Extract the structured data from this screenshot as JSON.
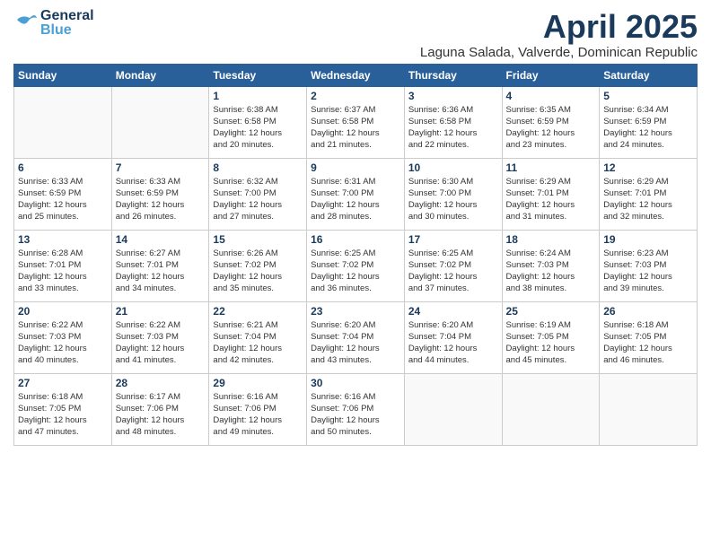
{
  "header": {
    "logo": {
      "general": "General",
      "blue": "Blue"
    },
    "title": "April 2025",
    "location": "Laguna Salada, Valverde, Dominican Republic"
  },
  "columns": [
    "Sunday",
    "Monday",
    "Tuesday",
    "Wednesday",
    "Thursday",
    "Friday",
    "Saturday"
  ],
  "weeks": [
    {
      "days": [
        {
          "num": "",
          "detail": ""
        },
        {
          "num": "",
          "detail": ""
        },
        {
          "num": "1",
          "detail": "Sunrise: 6:38 AM\nSunset: 6:58 PM\nDaylight: 12 hours\nand 20 minutes."
        },
        {
          "num": "2",
          "detail": "Sunrise: 6:37 AM\nSunset: 6:58 PM\nDaylight: 12 hours\nand 21 minutes."
        },
        {
          "num": "3",
          "detail": "Sunrise: 6:36 AM\nSunset: 6:58 PM\nDaylight: 12 hours\nand 22 minutes."
        },
        {
          "num": "4",
          "detail": "Sunrise: 6:35 AM\nSunset: 6:59 PM\nDaylight: 12 hours\nand 23 minutes."
        },
        {
          "num": "5",
          "detail": "Sunrise: 6:34 AM\nSunset: 6:59 PM\nDaylight: 12 hours\nand 24 minutes."
        }
      ]
    },
    {
      "days": [
        {
          "num": "6",
          "detail": "Sunrise: 6:33 AM\nSunset: 6:59 PM\nDaylight: 12 hours\nand 25 minutes."
        },
        {
          "num": "7",
          "detail": "Sunrise: 6:33 AM\nSunset: 6:59 PM\nDaylight: 12 hours\nand 26 minutes."
        },
        {
          "num": "8",
          "detail": "Sunrise: 6:32 AM\nSunset: 7:00 PM\nDaylight: 12 hours\nand 27 minutes."
        },
        {
          "num": "9",
          "detail": "Sunrise: 6:31 AM\nSunset: 7:00 PM\nDaylight: 12 hours\nand 28 minutes."
        },
        {
          "num": "10",
          "detail": "Sunrise: 6:30 AM\nSunset: 7:00 PM\nDaylight: 12 hours\nand 30 minutes."
        },
        {
          "num": "11",
          "detail": "Sunrise: 6:29 AM\nSunset: 7:01 PM\nDaylight: 12 hours\nand 31 minutes."
        },
        {
          "num": "12",
          "detail": "Sunrise: 6:29 AM\nSunset: 7:01 PM\nDaylight: 12 hours\nand 32 minutes."
        }
      ]
    },
    {
      "days": [
        {
          "num": "13",
          "detail": "Sunrise: 6:28 AM\nSunset: 7:01 PM\nDaylight: 12 hours\nand 33 minutes."
        },
        {
          "num": "14",
          "detail": "Sunrise: 6:27 AM\nSunset: 7:01 PM\nDaylight: 12 hours\nand 34 minutes."
        },
        {
          "num": "15",
          "detail": "Sunrise: 6:26 AM\nSunset: 7:02 PM\nDaylight: 12 hours\nand 35 minutes."
        },
        {
          "num": "16",
          "detail": "Sunrise: 6:25 AM\nSunset: 7:02 PM\nDaylight: 12 hours\nand 36 minutes."
        },
        {
          "num": "17",
          "detail": "Sunrise: 6:25 AM\nSunset: 7:02 PM\nDaylight: 12 hours\nand 37 minutes."
        },
        {
          "num": "18",
          "detail": "Sunrise: 6:24 AM\nSunset: 7:03 PM\nDaylight: 12 hours\nand 38 minutes."
        },
        {
          "num": "19",
          "detail": "Sunrise: 6:23 AM\nSunset: 7:03 PM\nDaylight: 12 hours\nand 39 minutes."
        }
      ]
    },
    {
      "days": [
        {
          "num": "20",
          "detail": "Sunrise: 6:22 AM\nSunset: 7:03 PM\nDaylight: 12 hours\nand 40 minutes."
        },
        {
          "num": "21",
          "detail": "Sunrise: 6:22 AM\nSunset: 7:03 PM\nDaylight: 12 hours\nand 41 minutes."
        },
        {
          "num": "22",
          "detail": "Sunrise: 6:21 AM\nSunset: 7:04 PM\nDaylight: 12 hours\nand 42 minutes."
        },
        {
          "num": "23",
          "detail": "Sunrise: 6:20 AM\nSunset: 7:04 PM\nDaylight: 12 hours\nand 43 minutes."
        },
        {
          "num": "24",
          "detail": "Sunrise: 6:20 AM\nSunset: 7:04 PM\nDaylight: 12 hours\nand 44 minutes."
        },
        {
          "num": "25",
          "detail": "Sunrise: 6:19 AM\nSunset: 7:05 PM\nDaylight: 12 hours\nand 45 minutes."
        },
        {
          "num": "26",
          "detail": "Sunrise: 6:18 AM\nSunset: 7:05 PM\nDaylight: 12 hours\nand 46 minutes."
        }
      ]
    },
    {
      "days": [
        {
          "num": "27",
          "detail": "Sunrise: 6:18 AM\nSunset: 7:05 PM\nDaylight: 12 hours\nand 47 minutes."
        },
        {
          "num": "28",
          "detail": "Sunrise: 6:17 AM\nSunset: 7:06 PM\nDaylight: 12 hours\nand 48 minutes."
        },
        {
          "num": "29",
          "detail": "Sunrise: 6:16 AM\nSunset: 7:06 PM\nDaylight: 12 hours\nand 49 minutes."
        },
        {
          "num": "30",
          "detail": "Sunrise: 6:16 AM\nSunset: 7:06 PM\nDaylight: 12 hours\nand 50 minutes."
        },
        {
          "num": "",
          "detail": ""
        },
        {
          "num": "",
          "detail": ""
        },
        {
          "num": "",
          "detail": ""
        }
      ]
    }
  ]
}
